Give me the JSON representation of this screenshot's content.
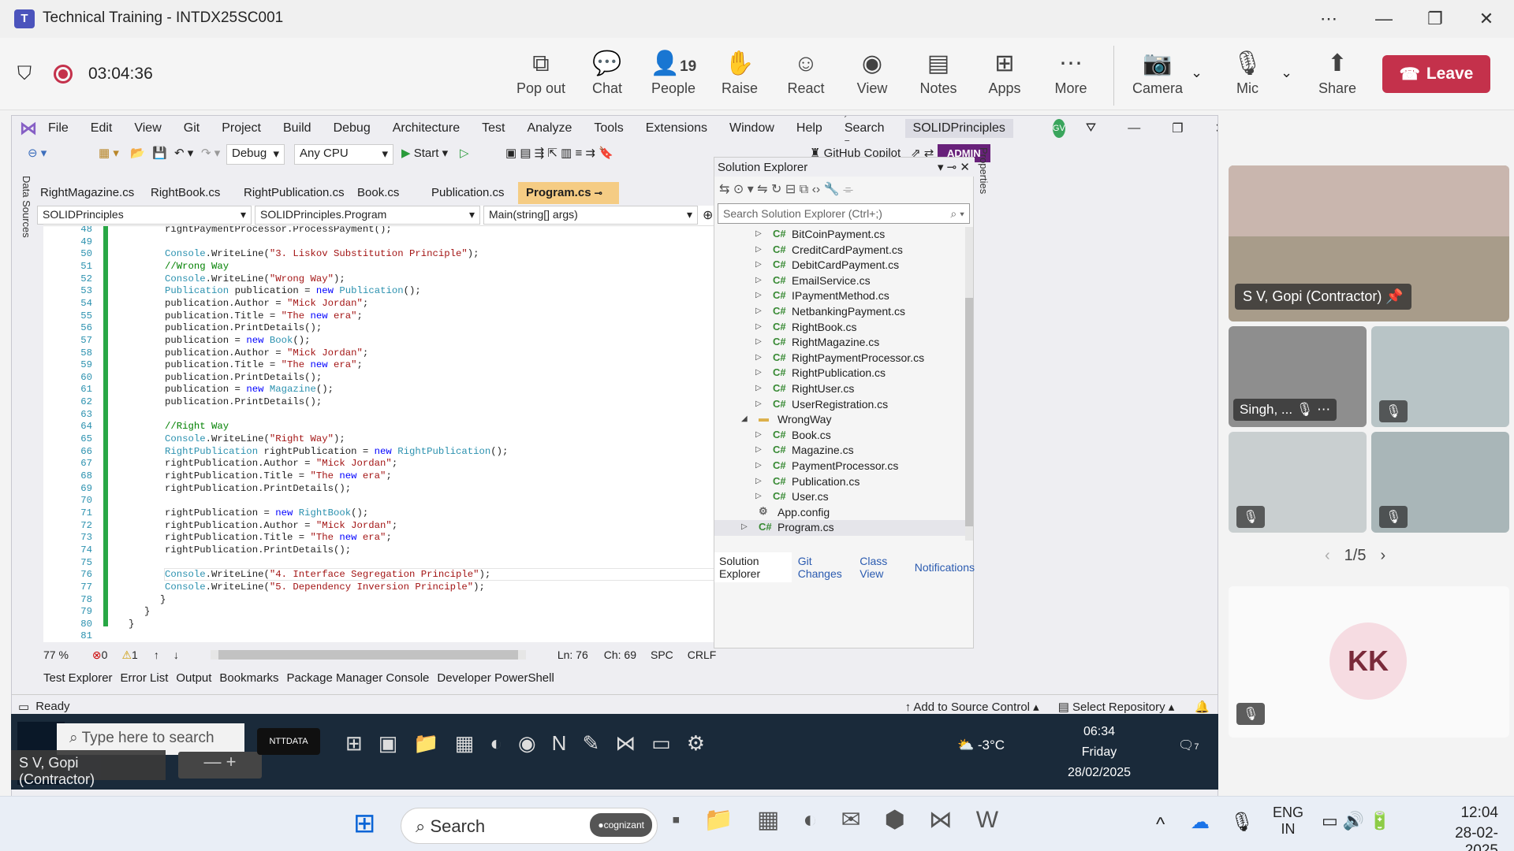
{
  "teams": {
    "title": "Technical Training - INTDX25SC001",
    "timer": "03:04:36",
    "toolbar": [
      {
        "label": "Pop out",
        "icon": "pop-out-icon"
      },
      {
        "label": "Chat",
        "icon": "chat-icon"
      },
      {
        "label": "People",
        "icon": "people-icon",
        "count": "19"
      },
      {
        "label": "Raise",
        "icon": "raise-hand-icon"
      },
      {
        "label": "React",
        "icon": "react-icon"
      },
      {
        "label": "View",
        "icon": "view-icon"
      },
      {
        "label": "Notes",
        "icon": "notes-icon"
      },
      {
        "label": "Apps",
        "icon": "apps-icon"
      },
      {
        "label": "More",
        "icon": "more-icon"
      },
      {
        "label": "Camera",
        "icon": "camera-off-icon"
      },
      {
        "label": "Mic",
        "icon": "mic-off-icon"
      },
      {
        "label": "Share",
        "icon": "share-icon"
      }
    ],
    "leave": "Leave"
  },
  "vs": {
    "menu": [
      "File",
      "Edit",
      "View",
      "Git",
      "Project",
      "Build",
      "Debug",
      "Architecture",
      "Test",
      "Analyze",
      "Tools",
      "Extensions",
      "Window",
      "Help"
    ],
    "search": "Search",
    "solution_title": "SOLIDPrinciples",
    "avatar": "GV",
    "config": "Debug",
    "platform": "Any CPU",
    "start": "Start",
    "copilot": "GitHub Copilot",
    "admin": "ADMIN",
    "tabs": [
      "RightMagazine.cs",
      "RightBook.cs",
      "RightPublication.cs",
      "Book.cs",
      "Publication.cs",
      "Program.cs"
    ],
    "nav": {
      "project": "SOLIDPrinciples",
      "class": "SOLIDPrinciples.Program",
      "member": "Main(string[] args)"
    },
    "side_left": "Data Sources",
    "side_right": "Properties",
    "code_lines": [
      {
        "n": "48",
        "t": "rightPaymentProcessor.ProcessPayment();"
      },
      {
        "n": "49",
        "t": ""
      },
      {
        "n": "50",
        "t": "Console.WriteLine(\"3. Liskov Substitution Principle\");"
      },
      {
        "n": "51",
        "t": "//Wrong Way"
      },
      {
        "n": "52",
        "t": "Console.WriteLine(\"Wrong Way\");"
      },
      {
        "n": "53",
        "t": "Publication publication = new Publication();"
      },
      {
        "n": "54",
        "t": "publication.Author = \"Mick Jordan\";"
      },
      {
        "n": "55",
        "t": "publication.Title = \"The new era\";"
      },
      {
        "n": "56",
        "t": "publication.PrintDetails();"
      },
      {
        "n": "57",
        "t": "publication = new Book();"
      },
      {
        "n": "58",
        "t": "publication.Author = \"Mick Jordan\";"
      },
      {
        "n": "59",
        "t": "publication.Title = \"The new era\";"
      },
      {
        "n": "60",
        "t": "publication.PrintDetails();"
      },
      {
        "n": "61",
        "t": "publication = new Magazine();"
      },
      {
        "n": "62",
        "t": "publication.PrintDetails();"
      },
      {
        "n": "63",
        "t": ""
      },
      {
        "n": "64",
        "t": "//Right Way"
      },
      {
        "n": "65",
        "t": "Console.WriteLine(\"Right Way\");"
      },
      {
        "n": "66",
        "t": "RightPublication rightPublication = new RightPublication();"
      },
      {
        "n": "67",
        "t": "rightPublication.Author = \"Mick Jordan\";"
      },
      {
        "n": "68",
        "t": "rightPublication.Title = \"The new era\";"
      },
      {
        "n": "69",
        "t": "rightPublication.PrintDetails();"
      },
      {
        "n": "70",
        "t": ""
      },
      {
        "n": "71",
        "t": "rightPublication = new RightBook();"
      },
      {
        "n": "72",
        "t": "rightPublication.Author = \"Mick Jordan\";"
      },
      {
        "n": "73",
        "t": "rightPublication.Title = \"The new era\";"
      },
      {
        "n": "74",
        "t": "rightPublication.PrintDetails();"
      },
      {
        "n": "75",
        "t": ""
      },
      {
        "n": "76",
        "t": "Console.WriteLine(\"4. Interface Segregation Principle\");"
      },
      {
        "n": "77",
        "t": "Console.WriteLine(\"5. Dependency Inversion Principle\");"
      },
      {
        "n": "78",
        "t": "}"
      },
      {
        "n": "79",
        "t": "}"
      },
      {
        "n": "80",
        "t": "}"
      },
      {
        "n": "81",
        "t": ""
      }
    ],
    "status": {
      "zoom": "77 %",
      "errors": "0",
      "warnings": "1",
      "ln": "Ln: 76",
      "ch": "Ch: 69",
      "spc": "SPC",
      "crlf": "CRLF"
    },
    "tool_tabs": [
      "Test Explorer",
      "Error List",
      "Output",
      "Bookmarks",
      "Package Manager Console",
      "Developer PowerShell"
    ],
    "statusbar": {
      "ready": "Ready",
      "source": "Add to Source Control",
      "repo": "Select Repository"
    },
    "solution_explorer": {
      "title": "Solution Explorer",
      "search": "Search Solution Explorer (Ctrl+;)",
      "items": [
        {
          "name": "BitCoinPayment.cs",
          "type": "cs"
        },
        {
          "name": "CreditCardPayment.cs",
          "type": "cs"
        },
        {
          "name": "DebitCardPayment.cs",
          "type": "cs"
        },
        {
          "name": "EmailService.cs",
          "type": "cs"
        },
        {
          "name": "IPaymentMethod.cs",
          "type": "cs"
        },
        {
          "name": "NetbankingPayment.cs",
          "type": "cs"
        },
        {
          "name": "RightBook.cs",
          "type": "cs"
        },
        {
          "name": "RightMagazine.cs",
          "type": "cs"
        },
        {
          "name": "RightPaymentProcessor.cs",
          "type": "cs"
        },
        {
          "name": "RightPublication.cs",
          "type": "cs"
        },
        {
          "name": "RightUser.cs",
          "type": "cs"
        },
        {
          "name": "UserRegistration.cs",
          "type": "cs"
        },
        {
          "name": "WrongWay",
          "type": "folder"
        },
        {
          "name": "Book.cs",
          "type": "cs"
        },
        {
          "name": "Magazine.cs",
          "type": "cs"
        },
        {
          "name": "PaymentProcessor.cs",
          "type": "cs"
        },
        {
          "name": "Publication.cs",
          "type": "cs"
        },
        {
          "name": "User.cs",
          "type": "cs"
        },
        {
          "name": "App.config",
          "type": "config"
        },
        {
          "name": "Program.cs",
          "type": "cs"
        }
      ],
      "tabs": [
        "Solution Explorer",
        "Git Changes",
        "Class View",
        "Notifications"
      ]
    }
  },
  "shared_taskbar": {
    "search": "Type here to search",
    "presenter": "S V, Gopi (Contractor)",
    "temp": "-3°C",
    "time": "06:34",
    "day": "Friday",
    "date": "28/02/2025",
    "notif": "7"
  },
  "participants": {
    "main": "S V, Gopi (Contractor)",
    "small": "Singh, ...",
    "page": "1/5",
    "initials": "KK",
    "initials_color": "#f6dce2"
  },
  "windows": {
    "search": "Search",
    "lang1": "ENG",
    "lang2": "IN",
    "time": "12:04",
    "date": "28-02-2025"
  }
}
